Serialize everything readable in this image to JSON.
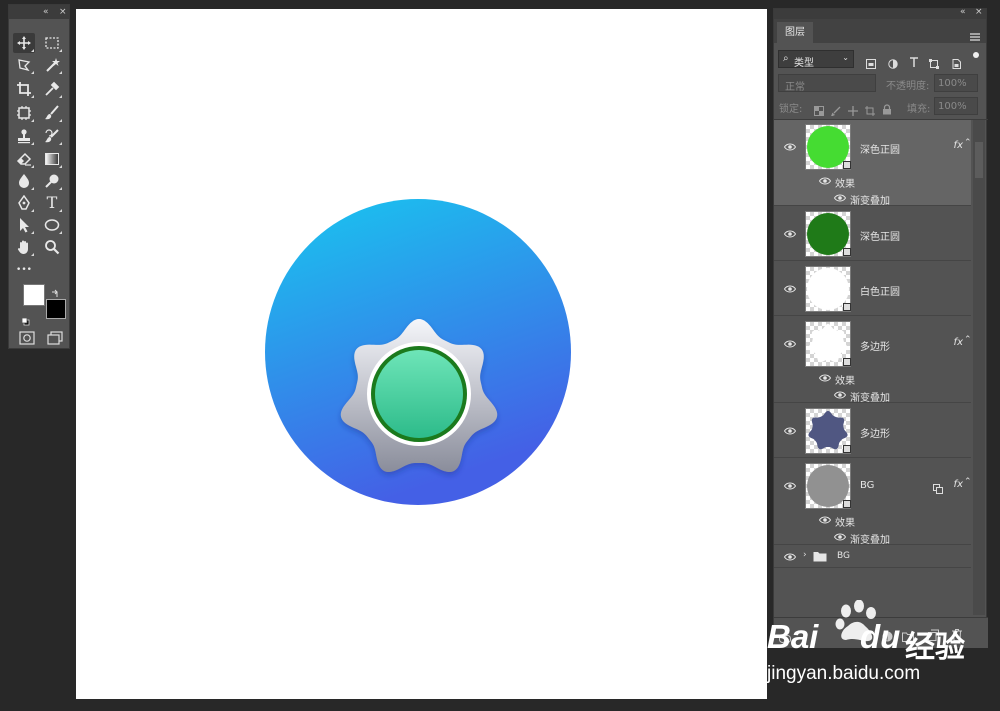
{
  "tools": {
    "toolbar_icons": [
      "move-icon",
      "marquee-icon",
      "lasso-icon",
      "magic-wand-icon",
      "crop-icon",
      "eyedropper-icon",
      "frame-icon",
      "brush-icon",
      "stamp-icon",
      "history-brush-icon",
      "eraser-icon",
      "gradient-icon",
      "blur-icon",
      "dodge-icon",
      "pen-icon",
      "type-icon",
      "path-select-icon",
      "ellipse-icon",
      "hand-icon",
      "zoom-icon",
      "more-icon"
    ],
    "type_tool_glyph": "T",
    "more_glyph": "•••",
    "fg_color": "#ffffff",
    "bg_color": "#000000"
  },
  "canvas": {
    "bg_circle_colors": [
      "#18c7ef",
      "#4460e6"
    ],
    "badge_colors": [
      "#f5f6fa",
      "#8a8d9b"
    ],
    "button_colors": [
      "#6ee5b8",
      "#2dbb8a"
    ],
    "ring_color": "#1b7a1d"
  },
  "layers_panel": {
    "tab_label": "图层",
    "filter_label": "类型",
    "blend_mode": "正常",
    "opacity_label": "不透明度:",
    "opacity_value": "100%",
    "lock_label": "锁定:",
    "fill_label": "填充:",
    "fill_value": "100%",
    "effects_label": "效果",
    "gradient_overlay_label": "渐变叠加",
    "fx_label": "fx",
    "layers": [
      {
        "name": "深色正圆",
        "thumb_color": "#45dc32",
        "has_fx": true,
        "selected": true
      },
      {
        "name": "深色正圆",
        "thumb_color": "#1f7a18",
        "has_fx": false,
        "selected": false
      },
      {
        "name": "白色正圆",
        "thumb_color": "#ffffff",
        "has_fx": false,
        "selected": false
      },
      {
        "name": "多边形",
        "thumb_color": "#ffffff",
        "has_fx": true,
        "selected": false
      },
      {
        "name": "多边形",
        "thumb_color": "#505782",
        "has_fx": false,
        "selected": false
      },
      {
        "name": "BG",
        "thumb_color": "#919191",
        "has_fx": true,
        "selected": false
      }
    ],
    "group_name": "BG"
  },
  "watermark": {
    "brand_text": "Bai",
    "brand_text2": "du",
    "product_text": "经验",
    "url_text": "jingyan.baidu.com"
  }
}
